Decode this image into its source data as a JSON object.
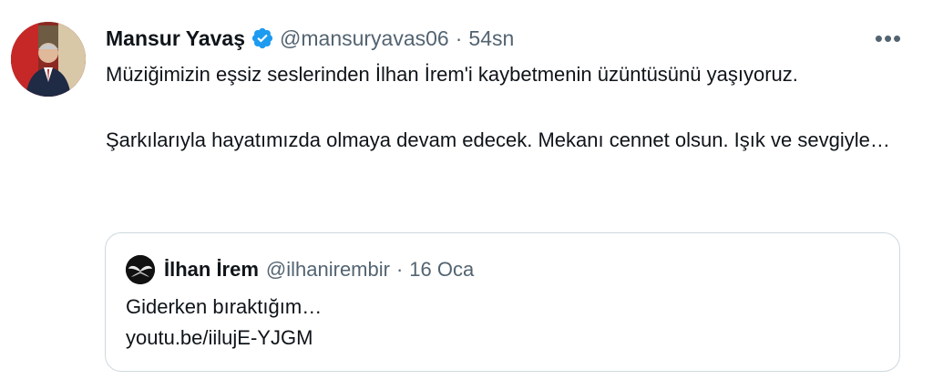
{
  "tweet": {
    "author_name": "Mansur Yavaş",
    "handle": "@mansuryavas06",
    "separator": "·",
    "time": "54sn",
    "more_label": "•••",
    "text_paragraph_1": "Müziğimizin eşsiz seslerinden İlhan İrem'i kaybetmenin üzüntüsünü yaşıyoruz.",
    "text_paragraph_2": "Şarkılarıyla hayatımızda olmaya devam edecek. Mekanı cennet olsun. Işık ve sevgiyle…"
  },
  "quoted": {
    "author_name": "İlhan İrem",
    "handle": "@ilhanirembir",
    "separator": "·",
    "time": "16 Oca",
    "text": "Giderken bıraktığım…",
    "link": "youtu.be/iilujE-YJGM"
  },
  "colors": {
    "verified_badge": "#1d9bf0",
    "secondary_text": "#536471",
    "border": "#cfd9de"
  }
}
